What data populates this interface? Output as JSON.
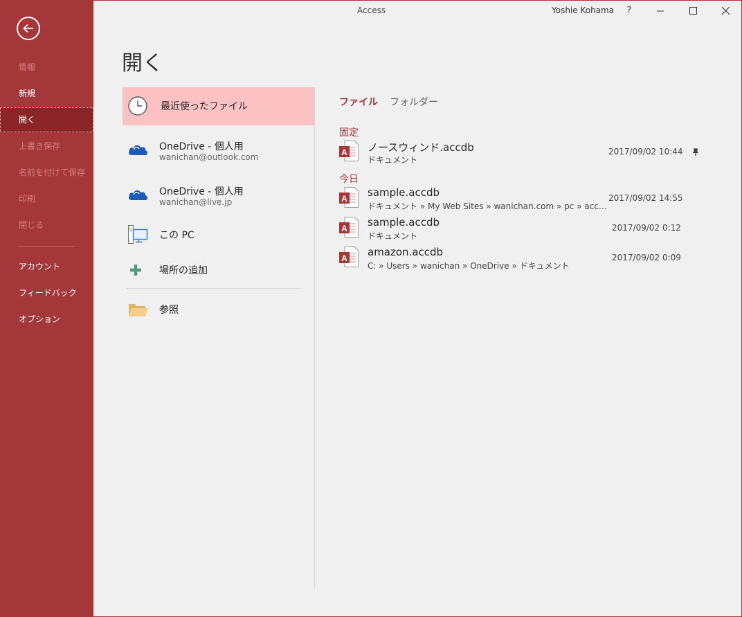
{
  "window": {
    "title": "Access",
    "user": "Yoshie Kohama",
    "help": "?"
  },
  "rail": {
    "items": [
      {
        "label": "情報",
        "state": "disabled"
      },
      {
        "label": "新規",
        "state": "normal"
      },
      {
        "label": "開く",
        "state": "selected"
      },
      {
        "label": "上書き保存",
        "state": "disabled"
      },
      {
        "label": "名前を付けて保存",
        "state": "disabled"
      },
      {
        "label": "印刷",
        "state": "disabled"
      },
      {
        "label": "閉じる",
        "state": "disabled"
      },
      {
        "label": "アカウント",
        "state": "normal"
      },
      {
        "label": "フィードバック",
        "state": "normal"
      },
      {
        "label": "オプション",
        "state": "normal"
      }
    ]
  },
  "page": {
    "title": "開く"
  },
  "places": {
    "recent": {
      "title": "最近使ったファイル",
      "icon": "clock-icon"
    },
    "onedrive1": {
      "title": "OneDrive - 個人用",
      "sub": "wanichan@outlook.com",
      "icon": "onedrive-cloud-icon"
    },
    "onedrive2": {
      "title": "OneDrive - 個人用",
      "sub": "wanichan@live.jp",
      "icon": "onedrive-cloud-icon"
    },
    "thispc": {
      "title": "この PC",
      "icon": "computer-icon"
    },
    "addplace": {
      "title": "場所の追加",
      "icon": "plus-icon"
    },
    "browse": {
      "title": "参照",
      "icon": "folder-icon"
    }
  },
  "tabs": {
    "files": "ファイル",
    "folders": "フォルダー"
  },
  "groups": {
    "pinned": "固定",
    "today": "今日"
  },
  "files": [
    {
      "name": "ノースウィンド.accdb",
      "path": "ドキュメント",
      "date": "2017/09/02 10:44",
      "pinned": true
    },
    {
      "name": "sample.accdb",
      "path": "ドキュメント » My Web Sites » wanichan.com » pc » acc…",
      "date": "2017/09/02 14:55"
    },
    {
      "name": "sample.accdb",
      "path": "ドキュメント",
      "date": "2017/09/02 0:12"
    },
    {
      "name": "amazon.accdb",
      "path": "C: » Users » wanichan » OneDrive » ドキュメント",
      "date": "2017/09/02 0:09"
    }
  ],
  "colors": {
    "accent": "#a4373a",
    "selected_place": "#fcc2c3",
    "background": "#f0f0f0"
  }
}
